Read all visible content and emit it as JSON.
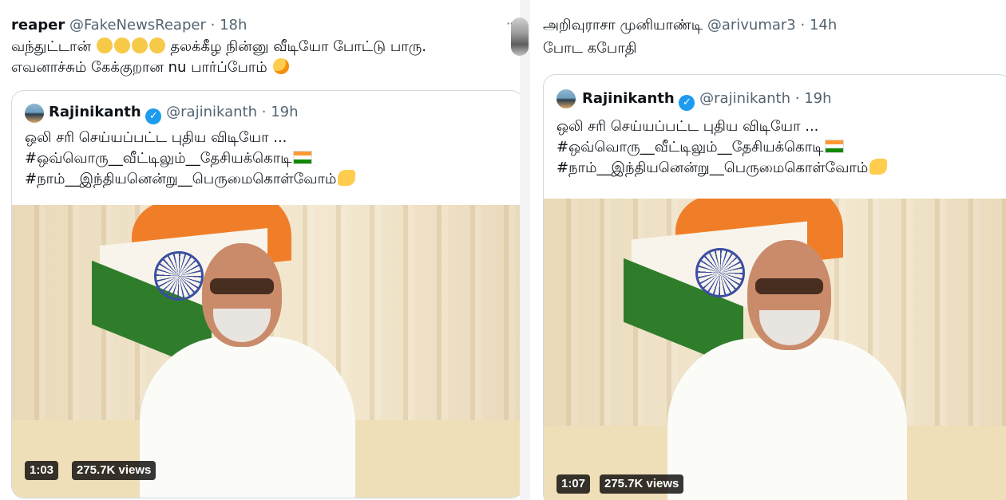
{
  "left_tweet": {
    "author_name": "reaper",
    "handle": "@FakeNewsReaper",
    "separator": "·",
    "time": "18h",
    "text_line1_a": "வந்துட்டான்",
    "text_line1_b": "தலக்கீழ நின்னு வீடியோ போட்டு பாரு.",
    "text_line2": "எவனாச்சும் கேக்குறான nu பார்ப்போம்",
    "quoted": {
      "author_name": "Rajinikanth",
      "handle": "@rajinikanth",
      "separator": "·",
      "time": "19h",
      "line1": "ஒலி சரி செய்யப்பட்ட புதிய விடியோ ...",
      "line2": "#ஒவ்வொரு__வீட்டிலும்__தேசியக்கொடி",
      "line3": "#நாம்__இந்தியனென்று__பெருமைகொள்வோம்",
      "video_duration": "1:03",
      "video_views": "275.7K views"
    }
  },
  "right_tweet": {
    "author_name": "அறிவுராசா முனியாண்டி",
    "handle": "@arivumar3",
    "separator": "·",
    "time": "14h",
    "text_line1": "போட கபோதி",
    "quoted": {
      "author_name": "Rajinikanth",
      "handle": "@rajinikanth",
      "separator": "·",
      "time": "19h",
      "line1": "ஒலி சரி செய்யப்பட்ட புதிய விடியோ ...",
      "line2": "#ஒவ்வொரு__வீட்டிலும்__தேசியக்கொடி",
      "line3": "#நாம்__இந்தியனென்று__பெருமைகொள்வோம்",
      "video_duration": "1:07",
      "video_views": "275.7K views"
    }
  },
  "more_icon_glyph": "··",
  "verified_glyph": "✓",
  "colors": {
    "text_primary": "#0f1419",
    "text_secondary": "#536471",
    "verified_blue": "#1d9bf0",
    "border": "#cfd9de"
  }
}
